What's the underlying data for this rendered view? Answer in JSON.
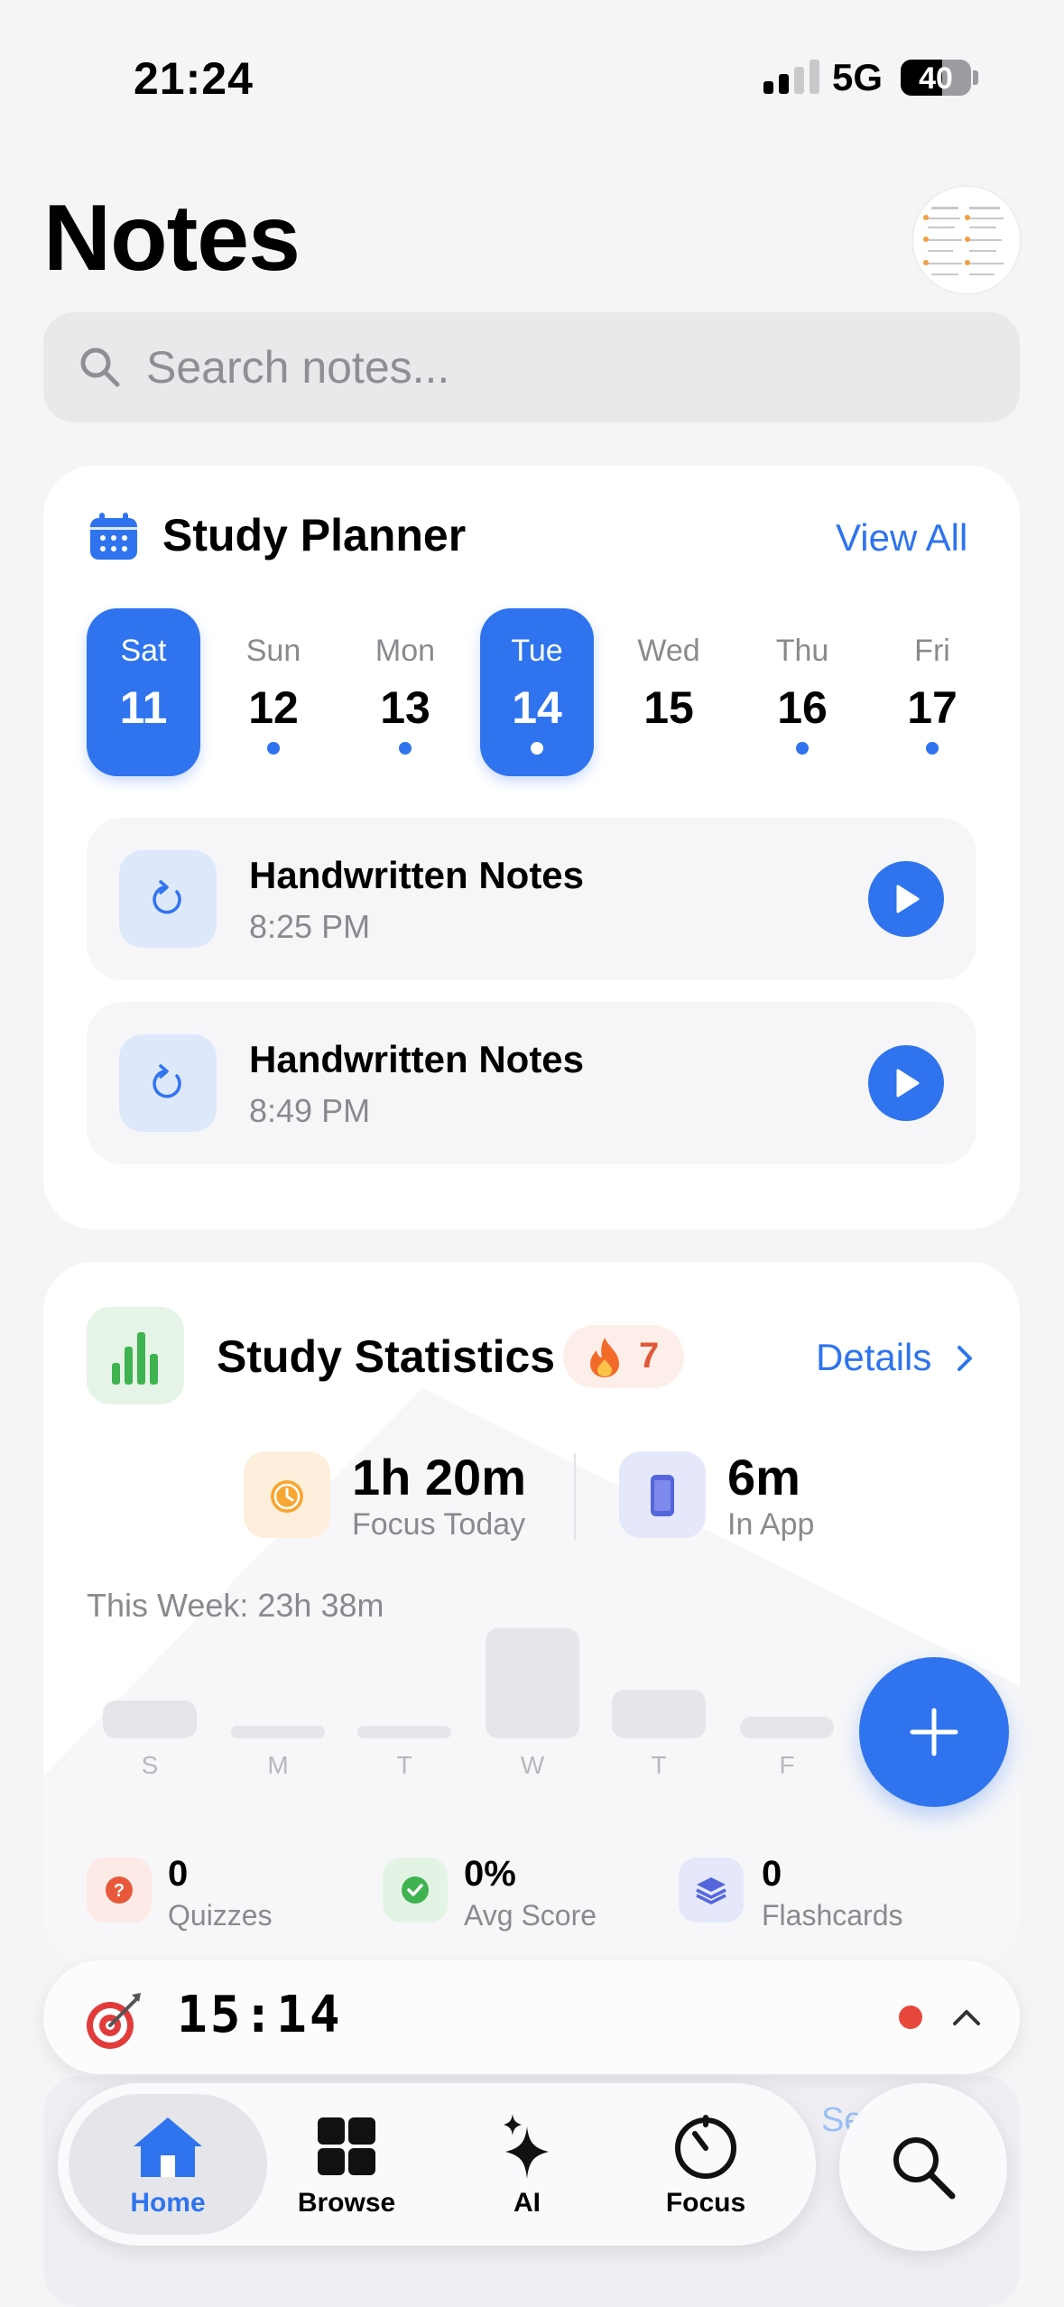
{
  "status_bar": {
    "time": "21:24",
    "network": "5G",
    "battery": "40"
  },
  "header": {
    "title": "Notes"
  },
  "search": {
    "placeholder": "Search notes..."
  },
  "planner": {
    "title": "Study Planner",
    "view_all": "View All",
    "days": [
      {
        "name": "Sat",
        "date": "11",
        "selected": true,
        "dot": false
      },
      {
        "name": "Sun",
        "date": "12",
        "selected": false,
        "dot": true
      },
      {
        "name": "Mon",
        "date": "13",
        "selected": false,
        "dot": true
      },
      {
        "name": "Tue",
        "date": "14",
        "selected": true,
        "dot": true
      },
      {
        "name": "Wed",
        "date": "15",
        "selected": false,
        "dot": false
      },
      {
        "name": "Thu",
        "date": "16",
        "selected": false,
        "dot": true
      },
      {
        "name": "Fri",
        "date": "17",
        "selected": false,
        "dot": true
      }
    ],
    "tasks": [
      {
        "title": "Handwritten Notes",
        "time": "8:25 PM"
      },
      {
        "title": "Handwritten Notes",
        "time": "8:49 PM"
      }
    ]
  },
  "stats": {
    "title": "Study Statistics",
    "streak": "7",
    "details": "Details",
    "focus_value": "1h 20m",
    "focus_label": "Focus Today",
    "inapp_value": "6m",
    "inapp_label": "In App",
    "week_total": "This Week: 23h 38m",
    "week_days": [
      "S",
      "M",
      "T",
      "W",
      "T",
      "F"
    ],
    "quizzes_value": "0",
    "quizzes_label": "Quizzes",
    "avg_value": "0%",
    "avg_label": "Avg Score",
    "flashcards_value": "0",
    "flashcards_label": "Flashcards"
  },
  "timer": {
    "time": "15:14"
  },
  "behind_text": "Se",
  "nav": {
    "items": [
      {
        "label": "Home",
        "icon": "home-icon",
        "active": true
      },
      {
        "label": "Browse",
        "icon": "grid-icon",
        "active": false
      },
      {
        "label": "AI",
        "icon": "sparkles-icon",
        "active": false
      },
      {
        "label": "Focus",
        "icon": "timer-icon",
        "active": false
      }
    ]
  },
  "colors": {
    "accent": "#2F74EE",
    "streak": "#E05A3A",
    "recording": "#E8473C"
  }
}
